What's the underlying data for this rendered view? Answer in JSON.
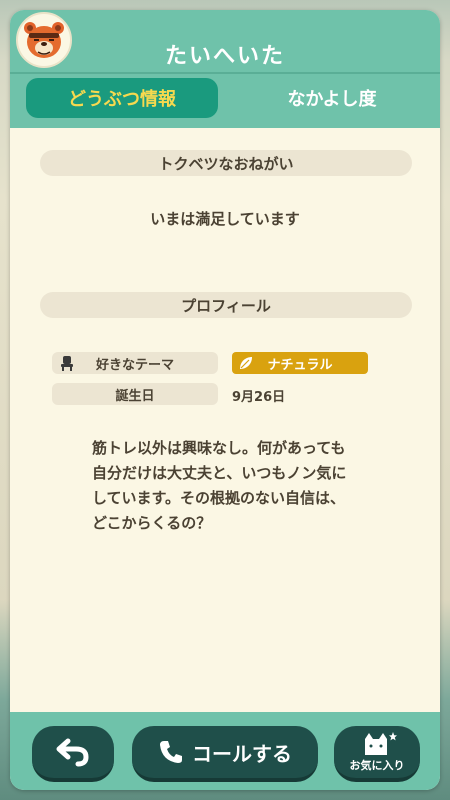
{
  "header": {
    "title": "たいへいた",
    "avatar_icon": "bear-villager-avatar-icon"
  },
  "tabs": [
    {
      "label": "どうぶつ情報",
      "active": true
    },
    {
      "label": "なかよし度",
      "active": false
    }
  ],
  "special_request": {
    "heading": "トクベツなおねがい",
    "text": "いまは満足しています"
  },
  "profile": {
    "heading": "プロフィール",
    "favorite_theme_label": "好きなテーマ",
    "favorite_theme_icon": "chair-icon",
    "favorite_theme_value": "ナチュラル",
    "favorite_theme_value_icon": "leaf-icon",
    "birthday_label": "誕生日",
    "birthday_value": "9月26日",
    "description": "筋トレ以外は興味なし。何があっても\n自分だけは大丈夫と、いつもノン気に\nしています。その根拠のない自信は、\nどこからくるの？"
  },
  "footer": {
    "back_icon": "back-arrow-icon",
    "call_icon": "phone-icon",
    "call_label": "コールする",
    "favorite_icon": "cat-star-icon",
    "favorite_label": "お気に入り"
  },
  "colors": {
    "header_green": "#6fc2aa",
    "active_tab": "#1a9a7e",
    "active_tab_text": "#f6d94f",
    "card_bg": "#fbf7e4",
    "theme_badge": "#d9a20f",
    "button_dark": "#1f4f4a"
  }
}
